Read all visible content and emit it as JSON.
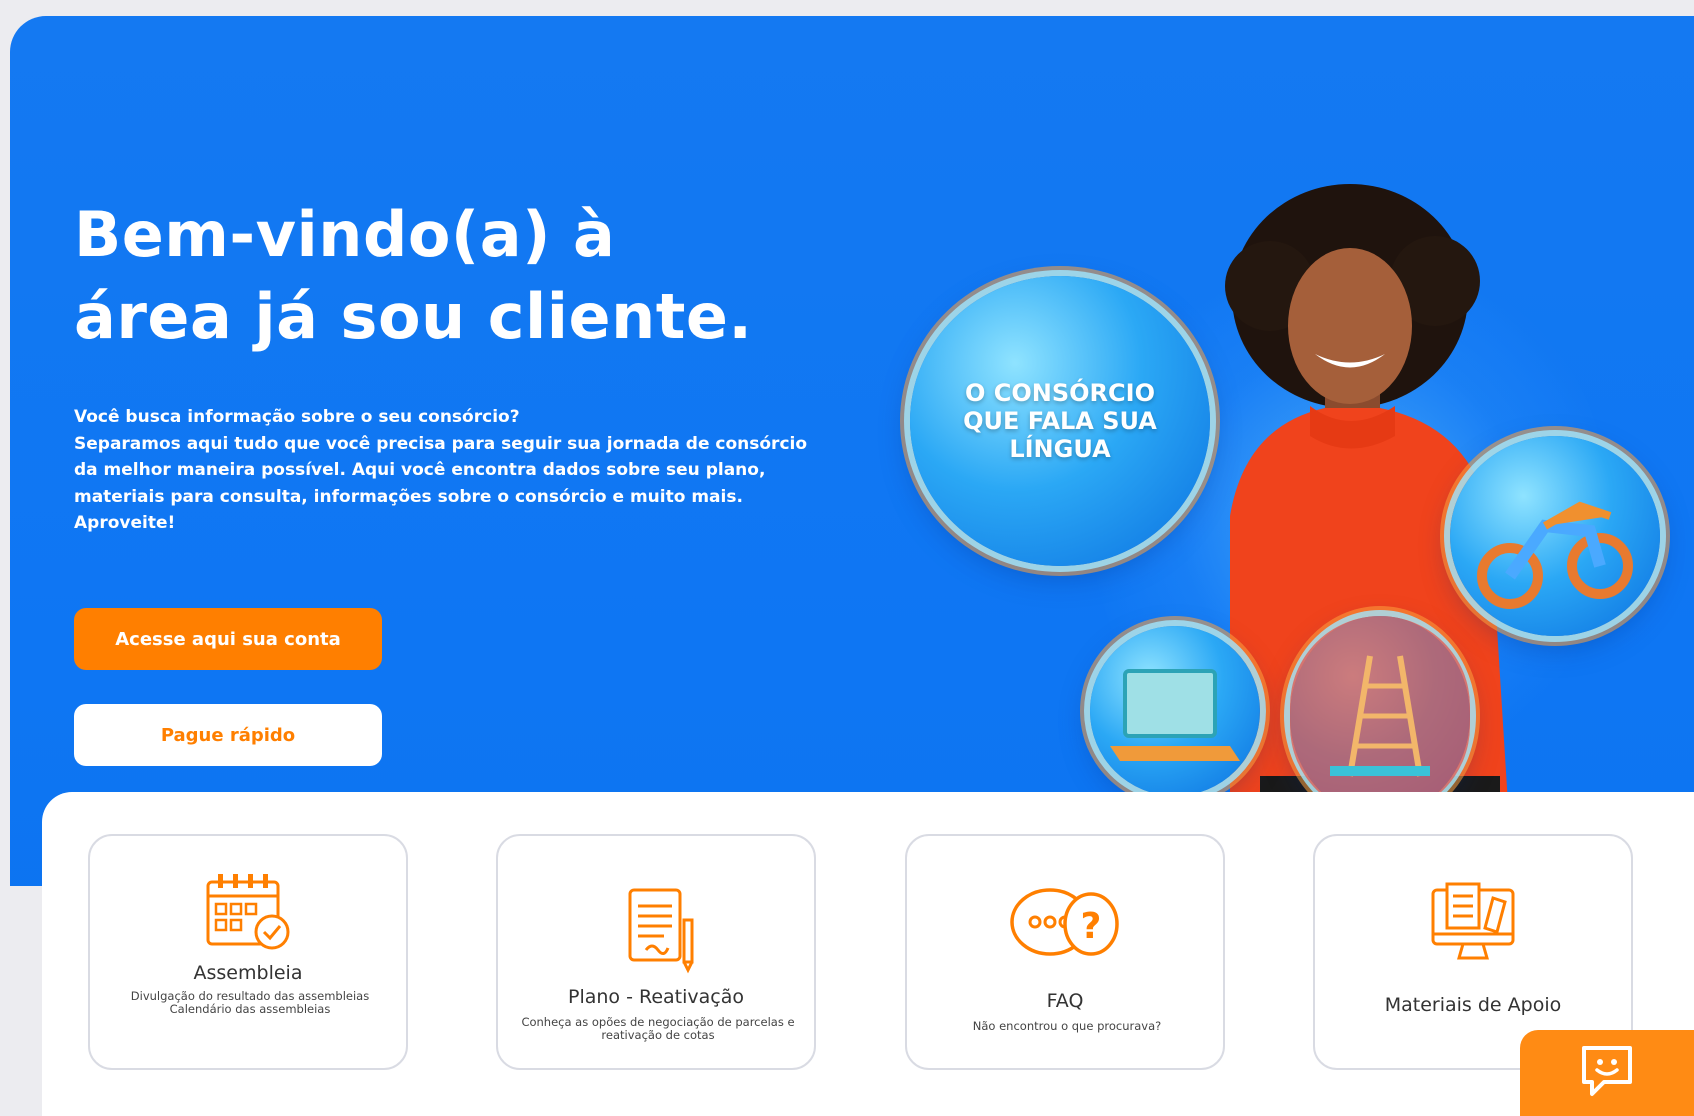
{
  "hero": {
    "title_line1": "Bem-vindo(a) à",
    "title_line2": "área já sou cliente.",
    "intro": [
      "Você busca informação sobre o seu consórcio?",
      "Separamos aqui tudo que você precisa para seguir sua jornada de consórcio da melhor maneira possível. Aqui você encontra dados sobre seu plano, materiais para consulta, informações sobre o consórcio e muito mais.",
      "Aproveite!"
    ],
    "primary_button": "Acesse aqui sua conta",
    "secondary_button": "Pague rápido",
    "bubble_text": "O CONSÓRCIO QUE FALA SUA LÍNGUA"
  },
  "cards": [
    {
      "title": "Assembleia",
      "desc": "Divulgação do resultado das assembleias Calendário das assembleias",
      "icon": "calendar-icon"
    },
    {
      "title": "Plano - Reativação",
      "desc": "Conheça as opões de negociação de parcelas e reativação de cotas",
      "icon": "document-pen-icon"
    },
    {
      "title": "FAQ",
      "desc": "Não encontrou o que procurava?",
      "icon": "chat-question-icon"
    },
    {
      "title": "Materiais de Apoio",
      "desc": "",
      "icon": "computer-icon"
    }
  ],
  "colors": {
    "brand_blue": "#0e76f3",
    "accent_orange": "#ff7f00"
  },
  "chat_icon": "chat-smile-icon"
}
